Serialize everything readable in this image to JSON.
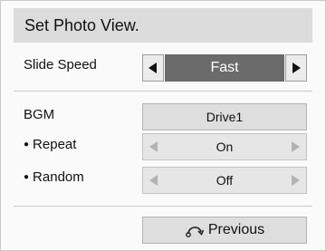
{
  "dialog": {
    "title": "Set Photo View."
  },
  "slide_speed": {
    "label": "Slide Speed",
    "value": "Fast",
    "left_arrow_icon": "left-arrow-icon",
    "right_arrow_icon": "right-arrow-icon"
  },
  "bgm": {
    "label": "BGM",
    "button_label": "Drive1"
  },
  "repeat": {
    "label": "Repeat",
    "value": "On"
  },
  "random": {
    "label": "Random",
    "value": "Off"
  },
  "footer": {
    "previous_label": "Previous",
    "previous_icon": "return-arrow-icon"
  },
  "colors": {
    "title_bar": "#dcdcdc",
    "active_value_bg": "#6b6b6b",
    "inactive_bg": "#e6e6e6",
    "button_bg": "#dedede"
  }
}
